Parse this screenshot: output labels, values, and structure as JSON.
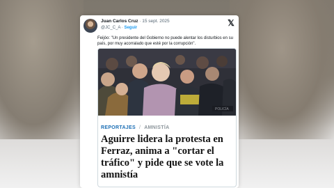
{
  "tweet": {
    "author_name": "Juan Carlos Cruz",
    "date": "15 sept. 2025",
    "handle": "@JC_C_A",
    "follow_label": "Seguir",
    "text": "Feijóo: \"Un presidente del Gobierno no puede alentar los disturbios en su país, por muy acorralado que esté por la corrupción\"."
  },
  "article": {
    "section": "REPORTAJES",
    "separator": "/",
    "tag": "AMNISTÍA",
    "headline": "Aguirre lidera la protesta en Ferraz, anima a \"cortar el tráfico\" y pide que se vote la amnistía"
  },
  "icons": {
    "platform_logo": "x-logo-icon",
    "avatar": "profile-avatar"
  },
  "colors": {
    "follow": "#1d9bf0",
    "section": "#1c6fb5",
    "tag": "#8b949a"
  }
}
